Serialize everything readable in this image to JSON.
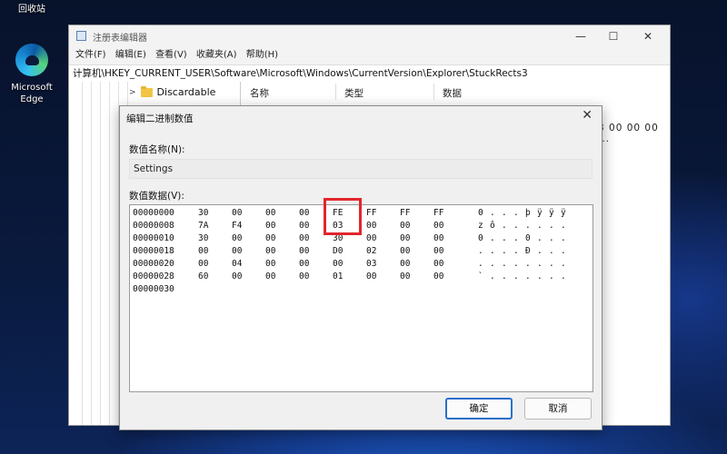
{
  "desktop": {
    "icons": [
      {
        "name": "回收站"
      },
      {
        "name": "Microsoft Edge"
      }
    ]
  },
  "regedit": {
    "title": "注册表编辑器",
    "window_buttons": {
      "minimize": "—",
      "maximize": "☐",
      "close": "✕"
    },
    "menu": [
      "文件(F)",
      "编辑(E)",
      "查看(V)",
      "收藏夹(A)",
      "帮助(H)"
    ],
    "address": "计算机\\HKEY_CURRENT_USER\\Software\\Microsoft\\Windows\\CurrentVersion\\Explorer\\StuckRects3",
    "tree_node": "Discardable",
    "columns": [
      "名称",
      "类型",
      "数据"
    ],
    "data_value_partial": "3 00 00 00 ..."
  },
  "dialog": {
    "title": "编辑二进制数值",
    "close": "✕",
    "value_name_label": "数值名称(N):",
    "value_name": "Settings",
    "value_data_label": "数值数据(V):",
    "hex_rows": [
      {
        "offset": "00000000",
        "bytes": [
          "30",
          "00",
          "00",
          "00",
          "FE",
          "FF",
          "FF",
          "FF"
        ],
        "ascii": [
          "0",
          ".",
          ".",
          ".",
          "þ",
          "ÿ",
          "ÿ",
          "ÿ"
        ]
      },
      {
        "offset": "00000008",
        "bytes": [
          "7A",
          "F4",
          "00",
          "00",
          "03",
          "00",
          "00",
          "00"
        ],
        "ascii": [
          "z",
          "ô",
          ".",
          ".",
          ".",
          ".",
          ".",
          "."
        ]
      },
      {
        "offset": "00000010",
        "bytes": [
          "30",
          "00",
          "00",
          "00",
          "30",
          "00",
          "00",
          "00"
        ],
        "ascii": [
          "0",
          ".",
          ".",
          ".",
          "0",
          ".",
          ".",
          "."
        ]
      },
      {
        "offset": "00000018",
        "bytes": [
          "00",
          "00",
          "00",
          "00",
          "D0",
          "02",
          "00",
          "00"
        ],
        "ascii": [
          ".",
          ".",
          ".",
          ".",
          "Ð",
          ".",
          ".",
          "."
        ]
      },
      {
        "offset": "00000020",
        "bytes": [
          "00",
          "04",
          "00",
          "00",
          "00",
          "03",
          "00",
          "00"
        ],
        "ascii": [
          ".",
          ".",
          ".",
          ".",
          ".",
          ".",
          ".",
          "."
        ]
      },
      {
        "offset": "00000028",
        "bytes": [
          "60",
          "00",
          "00",
          "00",
          "01",
          "00",
          "00",
          "00"
        ],
        "ascii": [
          "`",
          ".",
          ".",
          ".",
          ".",
          ".",
          ".",
          "."
        ]
      },
      {
        "offset": "00000030",
        "bytes": [],
        "ascii": []
      }
    ],
    "ok_label": "确定",
    "cancel_label": "取消"
  },
  "colors": {
    "highlight": "#e0262c",
    "ok_border": "#2b6fcc"
  }
}
